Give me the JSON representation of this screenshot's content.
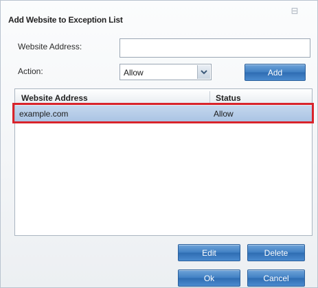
{
  "dialog": {
    "title": "Add Website to Exception List",
    "close_icon": "close-icon"
  },
  "form": {
    "address_label": "Website Address:",
    "address_value": "",
    "action_label": "Action:",
    "action_value": "Allow",
    "add_label": "Add"
  },
  "list": {
    "columns": [
      "Website Address",
      "Status"
    ],
    "rows": [
      {
        "address": "example.com",
        "status": "Allow",
        "selected": true
      }
    ]
  },
  "buttons": {
    "edit": "Edit",
    "delete": "Delete",
    "ok": "Ok",
    "cancel": "Cancel"
  },
  "colors": {
    "button_blue": "#3f7fc3",
    "selection": "#b7cdea",
    "highlight_border": "#d9232b"
  }
}
